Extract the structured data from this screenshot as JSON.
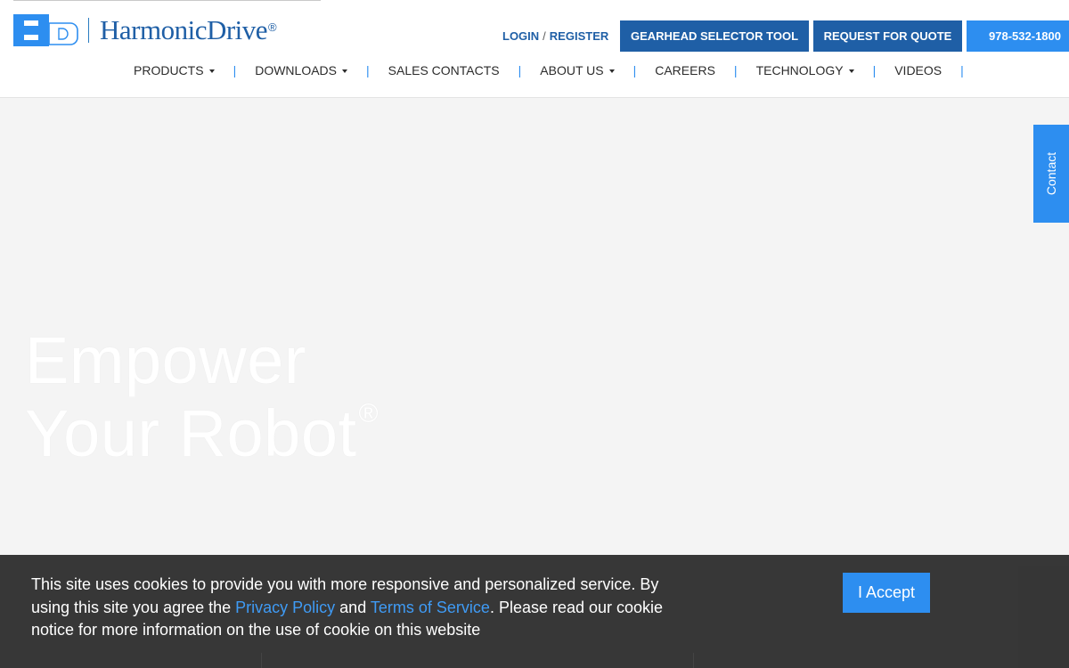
{
  "header": {
    "logo": {
      "mark_text": "HD",
      "brand": "HarmonicDrive",
      "reg": "®"
    },
    "login_label": "LOGIN",
    "login_sep": "/",
    "register_label": "REGISTER",
    "gearhead_label": "GEARHEAD SELECTOR TOOL",
    "quote_label": "REQUEST FOR QUOTE",
    "phone_label": "978-532-1800"
  },
  "nav": {
    "items": [
      {
        "label": "PRODUCTS",
        "dropdown": true
      },
      {
        "label": "DOWNLOADS",
        "dropdown": true
      },
      {
        "label": "SALES CONTACTS",
        "dropdown": false
      },
      {
        "label": "ABOUT US",
        "dropdown": true
      },
      {
        "label": "CAREERS",
        "dropdown": false
      },
      {
        "label": "TECHNOLOGY",
        "dropdown": true
      },
      {
        "label": "VIDEOS",
        "dropdown": false
      }
    ],
    "separator": "|"
  },
  "hero": {
    "line1": "Empower",
    "line2": "Your Robot",
    "reg": "®"
  },
  "contact_tab": {
    "label": "Contact"
  },
  "cookie": {
    "text_1": "This site uses cookies to provide you with more responsive and personalized service. By using this site you agree the ",
    "privacy_link": "Privacy Policy",
    "text_2": " and ",
    "terms_link": "Terms of Service",
    "text_3": ". Please read our cookie notice for more information on the use of cookie on this website",
    "accept_label": "I Accept"
  },
  "colors": {
    "brand_blue": "#1f5fa6",
    "accent_blue": "#2d8ef0",
    "banner_bg": "#2a2a2a"
  }
}
